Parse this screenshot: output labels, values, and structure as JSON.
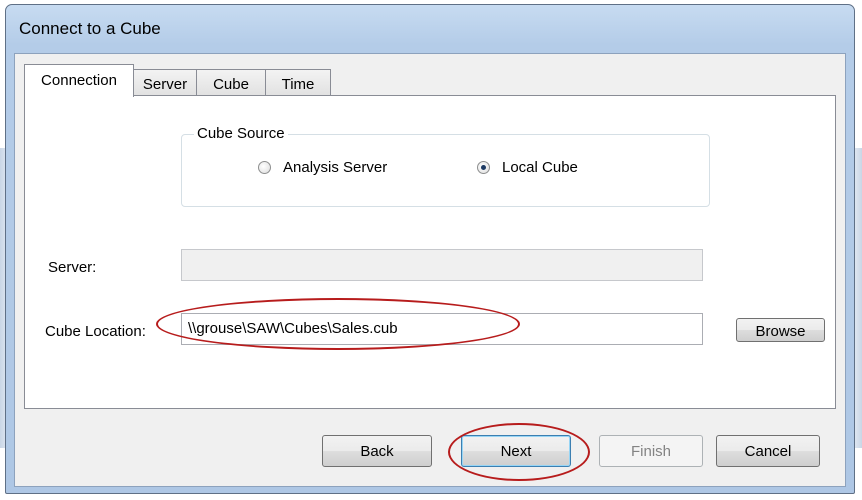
{
  "window": {
    "title": "Connect to a Cube"
  },
  "tabs": [
    {
      "label": "Connection",
      "active": true
    },
    {
      "label": "Server",
      "active": false
    },
    {
      "label": "Cube",
      "active": false
    },
    {
      "label": "Time",
      "active": false
    }
  ],
  "cube_source": {
    "legend": "Cube Source",
    "options": [
      {
        "label": "Analysis Server",
        "checked": false
      },
      {
        "label": "Local Cube",
        "checked": true
      }
    ]
  },
  "server": {
    "label": "Server:",
    "value": "",
    "enabled": false
  },
  "cube_location": {
    "label": "Cube Location:",
    "value": "\\\\grouse\\SAW\\Cubes\\Sales.cub",
    "browse_label": "Browse"
  },
  "footer": {
    "back_label": "Back",
    "next_label": "Next",
    "finish_label": "Finish",
    "cancel_label": "Cancel"
  },
  "annotation_color": "#b71c1c"
}
